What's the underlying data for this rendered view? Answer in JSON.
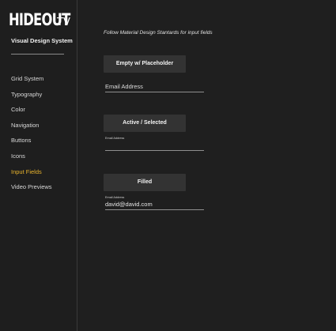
{
  "sidebar": {
    "logo_main": "HIDEOUT",
    "logo_suffix": "TV",
    "subtitle": "Visual Design System",
    "items": [
      {
        "label": "Grid System"
      },
      {
        "label": "Typography"
      },
      {
        "label": "Color"
      },
      {
        "label": "Navigation"
      },
      {
        "label": "Buttons"
      },
      {
        "label": "Icons"
      },
      {
        "label": "Input Fields",
        "active": true
      },
      {
        "label": "Video Previews"
      }
    ],
    "active_color": "#e8b32c"
  },
  "main": {
    "intro": "Follow Material Design Stantards for input fields",
    "sections": [
      {
        "button_label": "Empty w/ Placeholder",
        "field_label": "",
        "field_value": "Email Address"
      },
      {
        "button_label": "Active / Selected",
        "field_label": "Email Address",
        "field_value": ""
      },
      {
        "button_label": "Filled",
        "field_label": "Email Address",
        "field_value": "david@david.com"
      }
    ]
  }
}
